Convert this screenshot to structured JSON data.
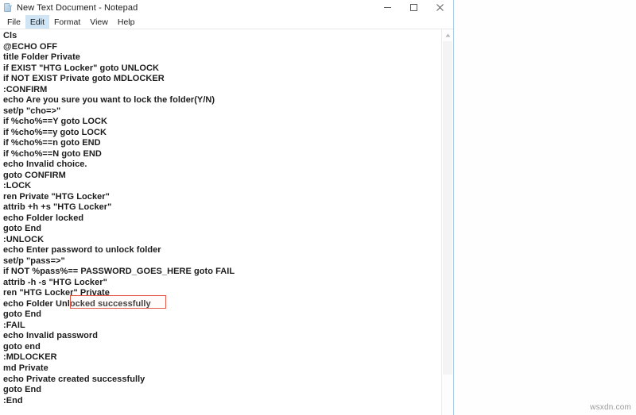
{
  "window": {
    "title": "New Text Document - Notepad",
    "icon": "notepad-document-icon",
    "controls": {
      "minimize": "–",
      "maximize": "□",
      "close": "✕"
    }
  },
  "menu": {
    "items": [
      {
        "label": "File",
        "active": false
      },
      {
        "label": "Edit",
        "active": true
      },
      {
        "label": "Format",
        "active": false
      },
      {
        "label": "View",
        "active": false
      },
      {
        "label": "Help",
        "active": false
      }
    ]
  },
  "editor": {
    "lines": [
      "Cls",
      "@ECHO OFF",
      "title Folder Private",
      "if EXIST \"HTG Locker\" goto UNLOCK",
      "if NOT EXIST Private goto MDLOCKER",
      ":CONFIRM",
      "echo Are you sure you want to lock the folder(Y/N)",
      "set/p \"cho=>\"",
      "if %cho%==Y goto LOCK",
      "if %cho%==y goto LOCK",
      "if %cho%==n goto END",
      "if %cho%==N goto END",
      "echo Invalid choice.",
      "goto CONFIRM",
      ":LOCK",
      "ren Private \"HTG Locker\"",
      "attrib +h +s \"HTG Locker\"",
      "echo Folder locked",
      "goto End",
      ":UNLOCK",
      "echo Enter password to unlock folder",
      "set/p \"pass=>\"",
      "if NOT %pass%== PASSWORD_GOES_HERE goto FAIL",
      "attrib -h -s \"HTG Locker\"",
      "ren \"HTG Locker\" Private",
      "echo Folder Unlocked successfully",
      "goto End",
      ":FAIL",
      "echo Invalid password",
      "goto end",
      ":MDLOCKER",
      "md Private",
      "echo Private created successfully",
      "goto End",
      ":End"
    ],
    "annotation": {
      "target_text": "PASSWORD_GOES_HERE",
      "box_color": "#e8574a",
      "line_index": 22
    }
  },
  "scrollbar": {
    "up_arrow_icon": "chevron-up-icon",
    "orientation": "vertical"
  },
  "watermark": {
    "text": "wsxdn.com"
  }
}
